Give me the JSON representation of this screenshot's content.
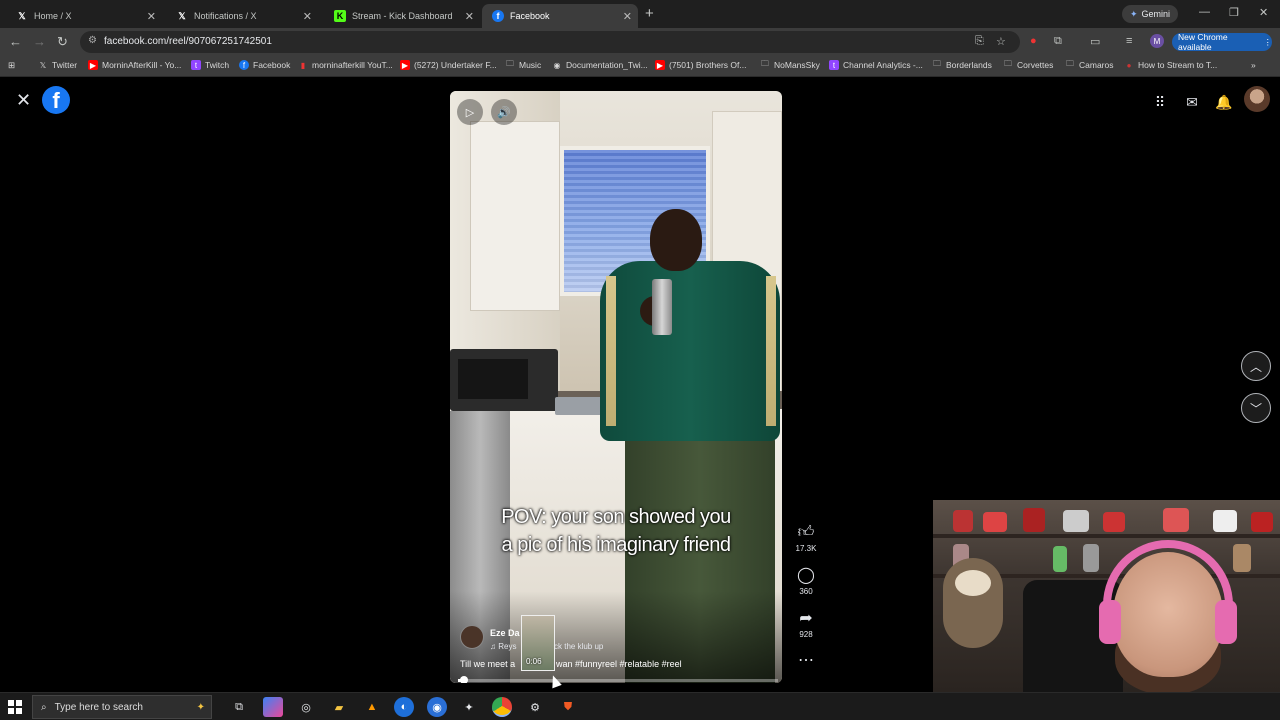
{
  "browser": {
    "tabs": [
      {
        "title": "Home / X",
        "icon": "x-logo-icon"
      },
      {
        "title": "Notifications / X",
        "icon": "x-logo-icon"
      },
      {
        "title": "Stream - Kick Dashboard",
        "icon": "kick-logo-icon"
      },
      {
        "title": "Facebook",
        "icon": "facebook-logo-icon"
      }
    ],
    "gemini_label": "Gemini",
    "url": "facebook.com/reel/907067251742501",
    "new_chrome_label": "New Chrome available",
    "profile_initial": "M"
  },
  "bookmarks": [
    {
      "label": "Twitter"
    },
    {
      "label": "MorninAfterKill - Yo..."
    },
    {
      "label": "Twitch"
    },
    {
      "label": "Facebook"
    },
    {
      "label": "morninafterkill YouT..."
    },
    {
      "label": "(5272) Undertaker F..."
    },
    {
      "label": "Music"
    },
    {
      "label": "Documentation_Twi..."
    },
    {
      "label": "(7501) Brothers Of..."
    },
    {
      "label": "NoMansSky"
    },
    {
      "label": "Channel Analytics -..."
    },
    {
      "label": "Borderlands"
    },
    {
      "label": "Corvettes"
    },
    {
      "label": "Camaros"
    },
    {
      "label": "How to Stream to T..."
    }
  ],
  "reel": {
    "caption_line1": "POV: your son showed you",
    "caption_line2": "a pic of his imaginary friend",
    "creator": "Eze Da",
    "music_prefix": "♫ Reys",
    "music_suffix": "ck the klub up",
    "desc_prefix": "Till we meet a",
    "desc_suffix": "wan #funnyreel #relatable #reel",
    "preview_time": "0:06",
    "progress": 0.02,
    "likes": "17.3K",
    "comments": "360",
    "shares": "928"
  },
  "taskbar": {
    "search_placeholder": "Type here to search"
  },
  "colors": {
    "facebook_blue": "#1877f2",
    "headset_pink": "#e56bb0"
  }
}
